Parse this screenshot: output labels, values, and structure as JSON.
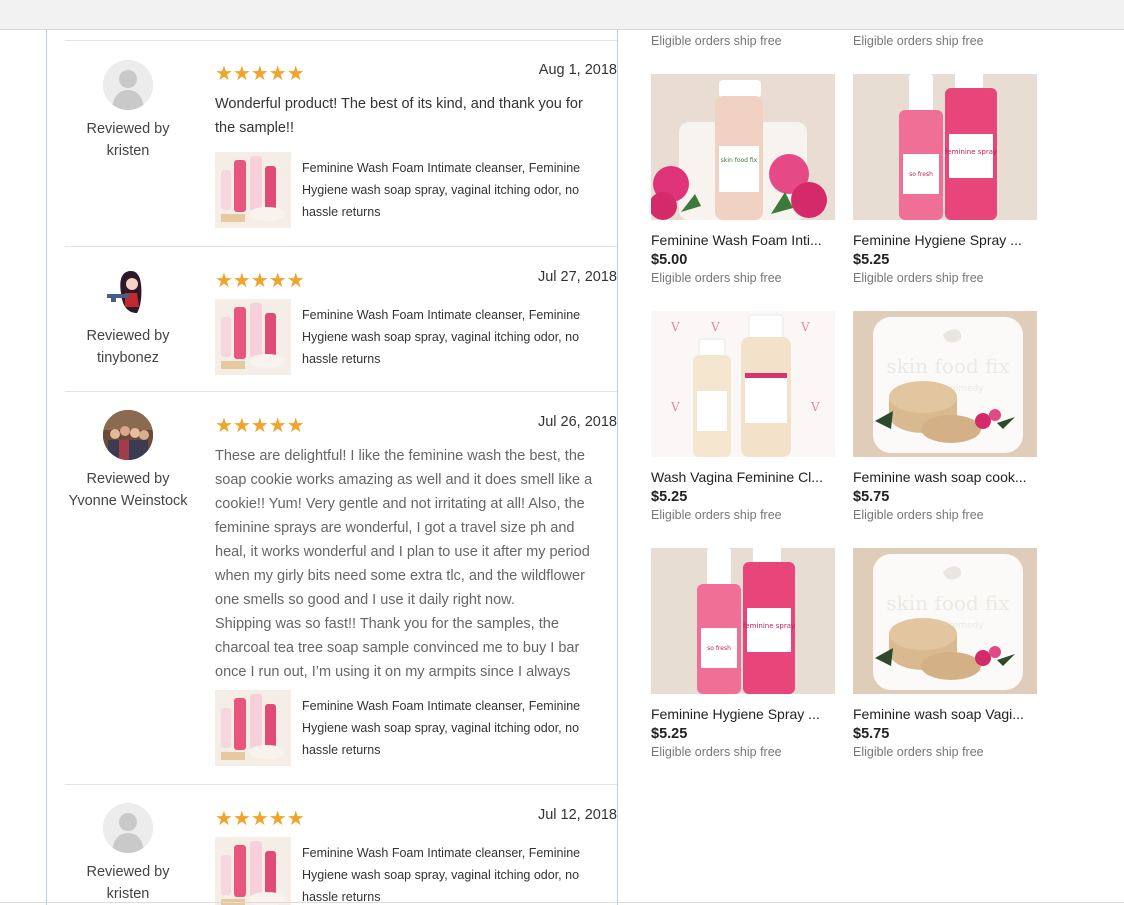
{
  "reviews": [
    {
      "reviewer_label": "Reviewed by",
      "reviewer_name": "kristen",
      "avatar": "default-person-icon",
      "stars": "★★★★★",
      "date": "Aug 1, 2018",
      "text_lines": [
        "Wonderful product! The best of its kind, and thank you for",
        "the sample!!"
      ],
      "listing_title": "Feminine Wash Foam Intimate cleanser, Feminine Hygiene wash soap spray, vaginal itching odor, no hassle returns"
    },
    {
      "reviewer_label": "Reviewed by",
      "reviewer_name": "tinybonez",
      "avatar": "anime-character-avatar",
      "stars": "★★★★★",
      "date": "Jul 27, 2018",
      "text_lines": [],
      "listing_title": "Feminine Wash Foam Intimate cleanser, Feminine Hygiene wash soap spray, vaginal itching odor, no hassle returns"
    },
    {
      "reviewer_label": "Reviewed by",
      "reviewer_name": "Yvonne Weinstock",
      "avatar": "group-photo-avatar",
      "stars": "★★★★★",
      "date": "Jul 26, 2018",
      "text_lines": [
        "These are delightful! I like the feminine wash the best, the",
        "soap cookie works amazing as well and it does smell like a",
        "cookie!! Yum! Very gentle and not irritating at all! Also, the",
        "feminine sprays are wonderful, I got a travel size ph and",
        "heal, it works wonderful and I plan to use it after my period",
        "when my girly bits need some extra tlc, and the wildflower",
        "one smells so good and I use it daily right now.",
        "Shipping was so fast!! Thank you for the samples, the",
        "charcoal tea tree soap sample convinced me to buy I bar",
        "once I run out, I’m using it on my armpits since I always"
      ],
      "listing_title": "Feminine Wash Foam Intimate cleanser, Feminine Hygiene wash soap spray, vaginal itching odor, no hassle returns"
    },
    {
      "reviewer_label": "Reviewed by",
      "reviewer_name": "kristen",
      "avatar": "default-person-icon",
      "stars": "★★★★★",
      "date": "Jul 12, 2018",
      "text_lines": [],
      "listing_title": "Feminine Wash Foam Intimate cleanser, Feminine Hygiene wash soap spray, vaginal itching odor, no hassle returns"
    }
  ],
  "products": {
    "top_ship_left": "Eligible orders ship free",
    "top_ship_right": "Eligible orders ship free",
    "items": [
      {
        "title": "Feminine Wash Foam Inti...",
        "price": "$5.00",
        "ship": "Eligible orders ship free",
        "image": "foam-wash-bottle-with-flowers"
      },
      {
        "title": "Feminine Hygiene Spray ...",
        "price": "$5.25",
        "ship": "Eligible orders ship free",
        "image": "pink-spray-bottles"
      },
      {
        "title": "Wash Vagina Feminine Cl...",
        "price": "$5.25",
        "ship": "Eligible orders ship free",
        "image": "wash-bottles-on-branded-backdrop"
      },
      {
        "title": "Feminine wash soap cook...",
        "price": "$5.75",
        "ship": "Eligible orders ship free",
        "image": "soap-cookies-on-dish"
      },
      {
        "title": "Feminine Hygiene Spray ...",
        "price": "$5.25",
        "ship": "Eligible orders ship free",
        "image": "pink-spray-bottles"
      },
      {
        "title": "Feminine wash soap Vagi...",
        "price": "$5.75",
        "ship": "Eligible orders ship free",
        "image": "soap-cookies-on-dish"
      }
    ]
  },
  "brand_text": {
    "skin_food_fix": "skin food fix",
    "natures_remedy": "natures remedy",
    "so_fresh": "so fresh",
    "feminine_spray": "feminine spray"
  },
  "colors": {
    "star": "#f1a42c",
    "panel_border": "#b9cfe0",
    "brand_pink": "#e0347a"
  }
}
